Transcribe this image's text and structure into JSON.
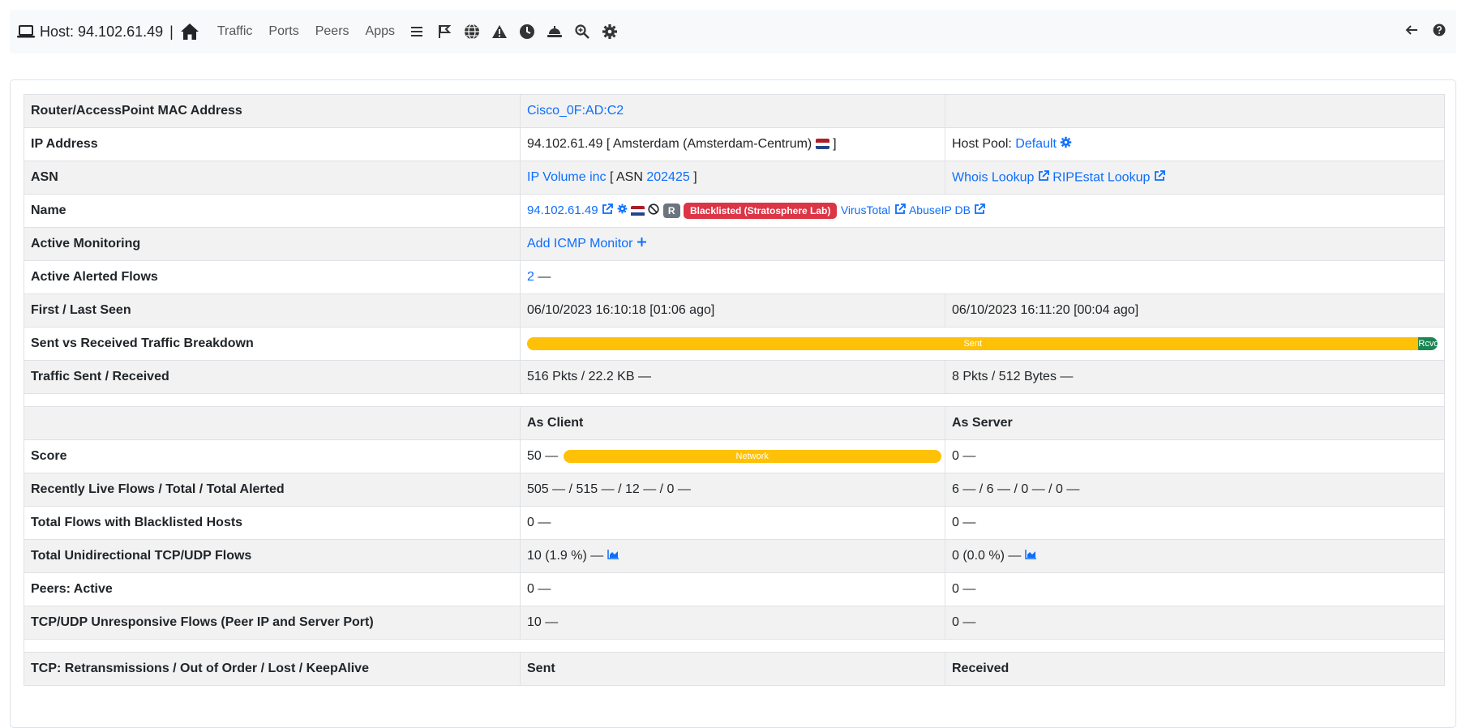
{
  "navbar": {
    "host_prefix": "Host:",
    "host_ip": "94.102.61.49",
    "separator": "|",
    "links": [
      "Traffic",
      "Ports",
      "Peers",
      "Apps"
    ],
    "icons": [
      "list-icon",
      "flag-icon",
      "globe-icon",
      "warning-icon",
      "clock-icon",
      "bell-icon",
      "zoom-icon",
      "gear-icon"
    ],
    "right_icons": [
      "arrow-left-icon",
      "help-icon"
    ]
  },
  "rows": {
    "mac": {
      "label": "Router/AccessPoint MAC Address",
      "value": "Cisco_0F:AD:C2"
    },
    "ip": {
      "label": "IP Address",
      "value": "94.102.61.49 [ Amsterdam (Amsterdam-Centrum)",
      "close": "]",
      "pool_label": "Host Pool:",
      "pool_value": "Default"
    },
    "asn": {
      "label": "ASN",
      "asn_name": "IP Volume inc",
      "asn_open": "[ ASN",
      "asn_number": "202425",
      "asn_close": "]",
      "whois": "Whois Lookup",
      "ripestat": "RIPEstat Lookup"
    },
    "name": {
      "label": "Name",
      "value": "94.102.61.49",
      "badge_r": "R",
      "blacklisted": "Blacklisted (Stratosphere Lab)",
      "virustotal": "VirusTotal",
      "abuseip": "AbuseIP DB"
    },
    "monitoring": {
      "label": "Active Monitoring",
      "value": "Add ICMP Monitor"
    },
    "alerted": {
      "label": "Active Alerted Flows",
      "value": "2",
      "trend": "—"
    },
    "seen": {
      "label": "First / Last Seen",
      "first": "06/10/2023 16:10:18 [01:06 ago]",
      "last": "06/10/2023 16:11:20 [00:04 ago]"
    },
    "breakdown": {
      "label": "Sent vs Received Traffic Breakdown",
      "sent_label": "Sent",
      "rcvd_label": "Rcvd",
      "sent_fraction": 0.979
    },
    "traffic": {
      "label": "Traffic Sent / Received",
      "sent": "516 Pkts / 22.2 KB —",
      "rcvd": "8 Pkts / 512 Bytes —"
    },
    "headers": {
      "client": "As Client",
      "server": "As Server"
    },
    "score": {
      "label": "Score",
      "client": "50 —",
      "network_label": "Network",
      "network_fraction": 1.0,
      "server": "0 —"
    },
    "live_flows": {
      "label": "Recently Live Flows / Total / Total Alerted",
      "client": "505 — / 515 — / 12 — / 0 —",
      "server": "6 — / 6 — / 0 — / 0 —"
    },
    "blacklisted_flows": {
      "label": "Total Flows with Blacklisted Hosts",
      "client": "0 —",
      "server": "0 —"
    },
    "unidir": {
      "label": "Total Unidirectional TCP/UDP Flows",
      "client": "10 (1.9 %) —",
      "server": "0 (0.0 %) —"
    },
    "peers": {
      "label": "Peers: Active",
      "client": "0 —",
      "server": "0 —"
    },
    "unresponsive": {
      "label": "TCP/UDP Unresponsive Flows (Peer IP and Server Port)",
      "client": "10 —",
      "server": "0 —"
    },
    "tcp": {
      "label": "TCP: Retransmissions / Out of Order / Lost / KeepAlive",
      "sent": "Sent",
      "received": "Received"
    }
  },
  "colors": {
    "link": "#0d6efd",
    "warning": "#ffc107",
    "success": "#198754",
    "danger": "#dc3545",
    "secondary": "#6c757d"
  }
}
